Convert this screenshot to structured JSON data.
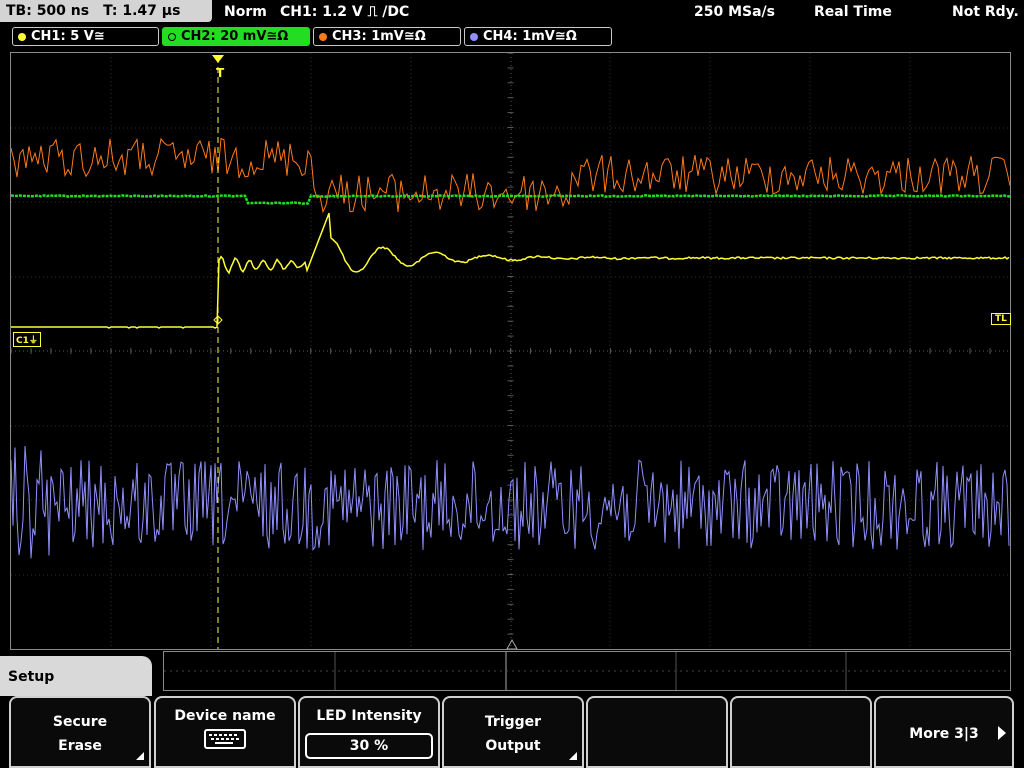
{
  "header": {
    "timebase": "TB: 500 ns",
    "trigger_time": "T: 1.47 µs",
    "mode": "Norm",
    "trigger": "CH1: 1.2 V ⎍ /DC",
    "sample_rate": "250 MSa/s",
    "acq_mode": "Real Time",
    "status": "Not Rdy."
  },
  "channels": [
    {
      "label": "CH1: 5 V≅",
      "color": "#ffff33"
    },
    {
      "label": "CH2: 20 mV≅Ω",
      "color": "#22dd22"
    },
    {
      "label": "CH3: 1mV≅Ω",
      "color": "#ff7a1a"
    },
    {
      "label": "CH4: 1mV≅Ω",
      "color": "#8f8fff"
    }
  ],
  "markers": {
    "c1": "C1⏚",
    "tl": "TL",
    "trigger": "T"
  },
  "menu": {
    "title": "Setup",
    "softkeys": [
      {
        "line1": "Secure",
        "line2": "Erase"
      },
      {
        "line1": "Device name",
        "icon": "keyboard-icon"
      },
      {
        "line1": "LED Intensity",
        "value": "30 %"
      },
      {
        "line1": "Trigger",
        "line2": "Output"
      },
      {
        "line1": ""
      },
      {
        "line1": ""
      },
      {
        "line1": "More 3|3"
      }
    ]
  }
}
